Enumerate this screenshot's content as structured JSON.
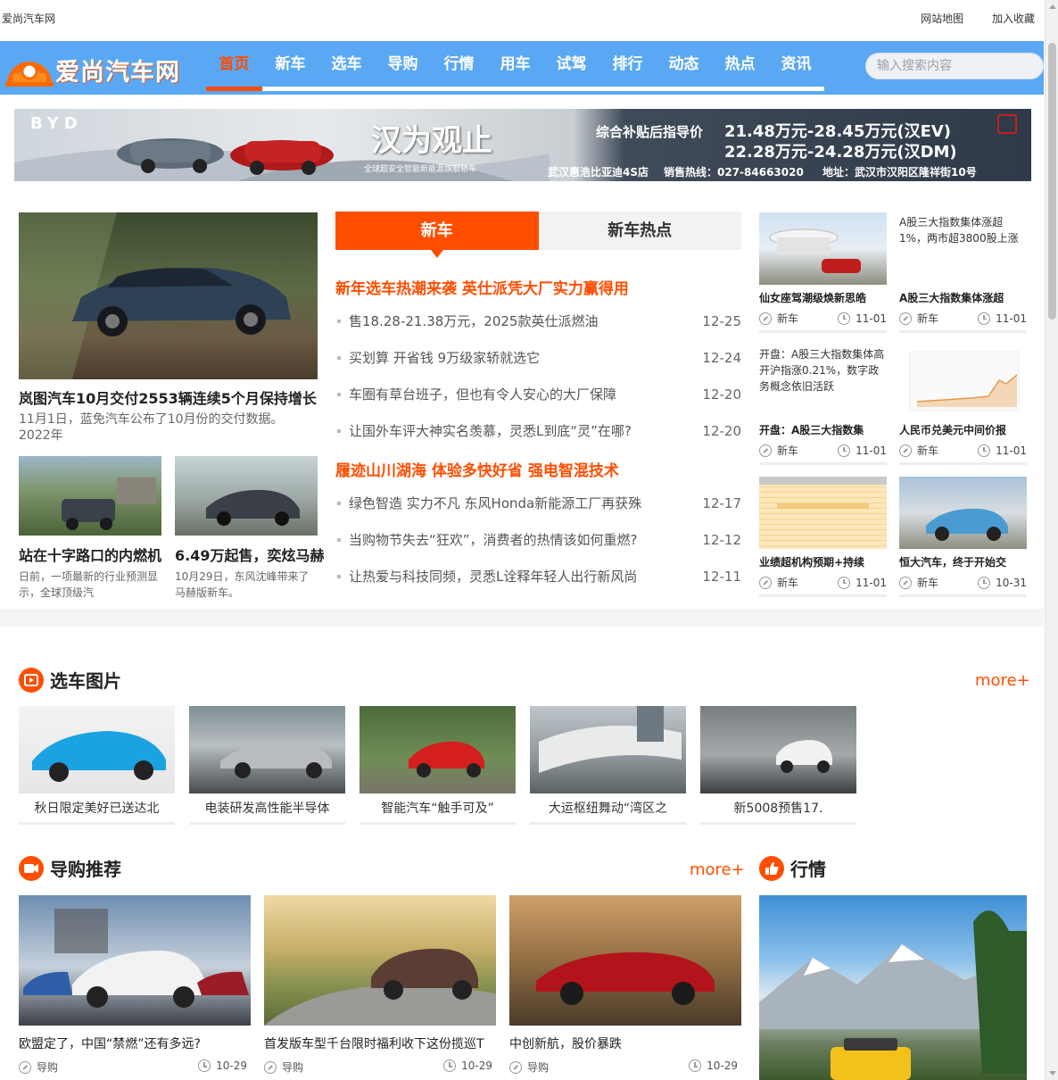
{
  "site": {
    "title": "爱尚汽车网",
    "logo_text": "爱尚汽车网"
  },
  "topbar": {
    "sitemap": "网站地图",
    "favorite": "加入收藏"
  },
  "nav": {
    "items": [
      "首页",
      "新车",
      "选车",
      "导购",
      "行情",
      "用车",
      "试驾",
      "排行",
      "动态",
      "热点",
      "资讯"
    ],
    "active": "首页"
  },
  "search": {
    "placeholder": "输入搜索内容"
  },
  "banner": {
    "brand": "BYD",
    "slogan": "汉为观止",
    "slogan_sub": "全球超安全智能新能源旗舰轿车",
    "price_label": "综合补贴后指导价",
    "price_ev": "21.48万元-28.45万元(汉EV)",
    "price_dm": "22.28万元-24.28万元(汉DM)",
    "dealer": "武汉惠浩比亚迪4S店",
    "hotline": "销售热线：027-84663020",
    "address": "地址：武汉市汉阳区隆祥街10号"
  },
  "feature": {
    "main": {
      "title": "岚图汽车10月交付2553辆连续5个月保持增长",
      "desc": "11月1日，蓝免汽车公布了10月份的交付数据。2022年"
    },
    "sub": [
      {
        "title": "站在十字路口的内燃机",
        "desc": "日前，一项最新的行业预测显示，全球顶级汽"
      },
      {
        "title": "6.49万起售，奕炫马赫",
        "desc": "10月29日，东风沈峰带来了马赫版新车。"
      }
    ]
  },
  "tabs": {
    "labels": [
      "新车",
      "新车热点"
    ],
    "active": 0
  },
  "news": {
    "headline1": "新年选车热潮来袭 英仕派凭大厂实力赢得用",
    "list1": [
      {
        "title": "售18.28-21.38万元，2025款英仕派燃油",
        "date": "12-25"
      },
      {
        "title": "买划算 开省钱 9万级家轿就选它",
        "date": "12-24"
      },
      {
        "title": "车圈有草台班子，但也有令人安心的大厂保障",
        "date": "12-20"
      },
      {
        "title": "让国外车评大神实名羡慕，灵悉L到底“灵”在哪?",
        "date": "12-20"
      }
    ],
    "headline2": "履迹山川湖海 体验多快好省 强电智混技术",
    "list2": [
      {
        "title": "绿色智造 实力不凡 东风Honda新能源工厂再获殊",
        "date": "12-17"
      },
      {
        "title": "当购物节失去“狂欢”，消费者的热情该如何重燃?",
        "date": "12-12"
      },
      {
        "title": "让热爱与科技同频，灵悉L诠释年轻人出行新风尚",
        "date": "12-11"
      }
    ]
  },
  "right_cards": [
    {
      "caption": "仙女座驾潮级焕新思皓",
      "tag": "新车",
      "date": "11-01",
      "alt": ""
    },
    {
      "caption": "A股三大指数集体涨超",
      "tag": "新车",
      "date": "11-01",
      "alt": "A股三大指数集体涨超1%，两市超3800股上涨"
    },
    {
      "caption": "开盘：A股三大指数集",
      "tag": "新车",
      "date": "11-01",
      "alt": "开盘：A股三大指数集体高开沪指涨0.21%，数字政务概念依旧活跃"
    },
    {
      "caption": "人民币兑美元中间价报",
      "tag": "新车",
      "date": "11-01",
      "alt": ""
    },
    {
      "caption": "业绩超机构预期+持续",
      "tag": "新车",
      "date": "11-01",
      "alt": ""
    },
    {
      "caption": "恒大汽车，终于开始交",
      "tag": "新车",
      "date": "10-31",
      "alt": ""
    }
  ],
  "pick_section": {
    "title": "选车图片",
    "more": "more+",
    "items": [
      "秋日限定美好已送达北",
      "电装研发高性能半导体",
      "智能汽车“触手可及”",
      "大运枢纽舞动“湾区之",
      "新5008预售17."
    ]
  },
  "guide_section": {
    "title": "导购推荐",
    "more": "more+",
    "items": [
      {
        "title": "欧盟定了，中国“禁燃”还有多远?",
        "tag": "导购",
        "date": "10-29"
      },
      {
        "title": "首发版车型千台限时福利收下这份揽巡T",
        "tag": "导购",
        "date": "10-29"
      },
      {
        "title": "中创新航，股价暴跌",
        "tag": "导购",
        "date": "10-29"
      }
    ]
  },
  "market_section": {
    "title": "行情"
  }
}
